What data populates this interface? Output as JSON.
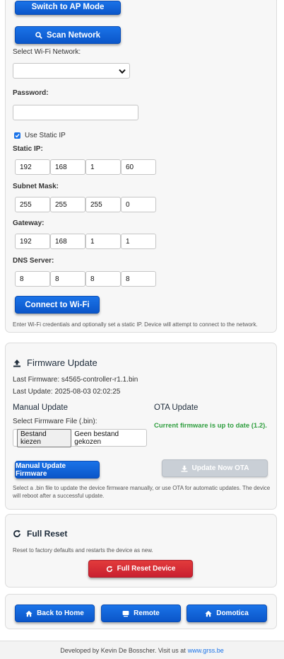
{
  "wifi": {
    "cropped_button_label": "Switch to AP Mode",
    "scan_button": "Scan Network",
    "select_label": "Select Wi-Fi Network:",
    "select_value": "",
    "password_label": "Password:",
    "password_value": "",
    "static_ip_checkbox": "Use Static IP",
    "static_ip_checked": true,
    "static_ip_label": "Static IP:",
    "static_ip": [
      "192",
      "168",
      "1",
      "60"
    ],
    "subnet_label": "Subnet Mask:",
    "subnet": [
      "255",
      "255",
      "255",
      "0"
    ],
    "gateway_label": "Gateway:",
    "gateway": [
      "192",
      "168",
      "1",
      "1"
    ],
    "dns_label": "DNS Server:",
    "dns": [
      "8",
      "8",
      "8",
      "8"
    ],
    "connect_button": "Connect to Wi-Fi",
    "help_text": "Enter Wi-Fi credentials and optionally set a static IP. Device will attempt to connect to the network."
  },
  "firmware": {
    "title": "Firmware Update",
    "last_firmware": "Last Firmware: s4565-controller-r1.1.bin",
    "last_update": "Last Update: 2025-08-03 02:02:25",
    "manual_title": "Manual Update",
    "select_file_label": "Select Firmware File (.bin):",
    "choose_file_button": "Bestand kiezen",
    "no_file_text": "Geen bestand gekozen",
    "manual_button": "Manual Update Firmware",
    "ota_title": "OTA Update",
    "ota_status": "Current firmware is up to date (1.2).",
    "ota_button": "Update Now OTA",
    "help_text": "Select a .bin file to update the device firmware manually, or use OTA for automatic updates. The device will reboot after a successful update."
  },
  "reset": {
    "title": "Full Reset",
    "description": "Reset to factory defaults and restarts the device as new.",
    "button": "Full Reset Device"
  },
  "nav": {
    "home": "Back to Home",
    "remote": "Remote",
    "domotica": "Domotica"
  },
  "footer": {
    "text": "Developed by Kevin De Bosscher. Visit us at",
    "link": "www.grss.be"
  },
  "colors": {
    "primary": "#1a73e8",
    "danger": "#d32f3f",
    "success": "#2e9e3e",
    "disabled": "#c9cfd6"
  }
}
